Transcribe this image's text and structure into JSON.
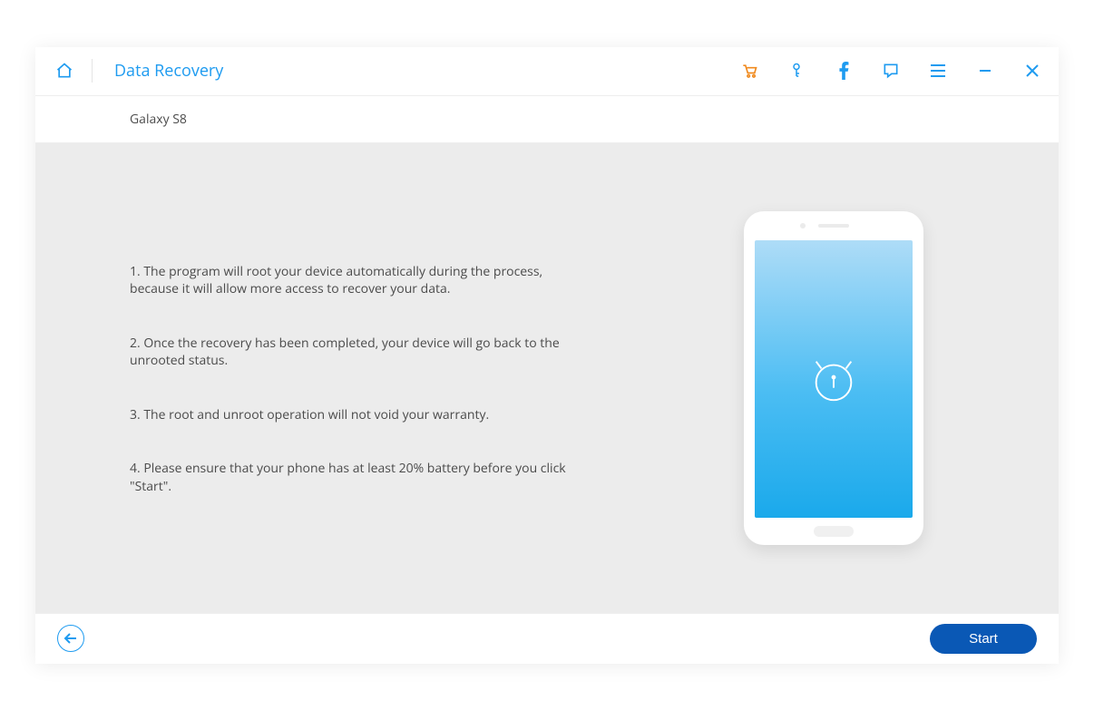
{
  "header": {
    "title": "Data Recovery"
  },
  "subheader": {
    "device_name": "Galaxy S8"
  },
  "content": {
    "steps": {
      "s1": "1. The program will root your device automatically during the process, because it will allow more access to recover your data.",
      "s2": "2. Once the recovery has been completed, your device will go back to the unrooted status.",
      "s3": "3. The root and unroot operation will not void your warranty.",
      "s4": "4. Please ensure that your phone has at least 20% battery before you click \"Start\"."
    }
  },
  "footer": {
    "start_label": "Start"
  },
  "icons": {
    "home": "home-icon",
    "cart": "cart-icon",
    "key": "key-icon",
    "facebook": "facebook-icon",
    "comment": "comment-icon",
    "menu": "menu-icon",
    "minimize": "minimize-icon",
    "close": "close-icon",
    "back": "back-arrow-icon",
    "android": "android-icon"
  },
  "colors": {
    "accent_blue": "#1e9bf0",
    "accent_orange": "#f08a1e",
    "primary_button": "#0a58b5",
    "body_text": "#4b4b4b",
    "content_bg": "#ececec"
  }
}
